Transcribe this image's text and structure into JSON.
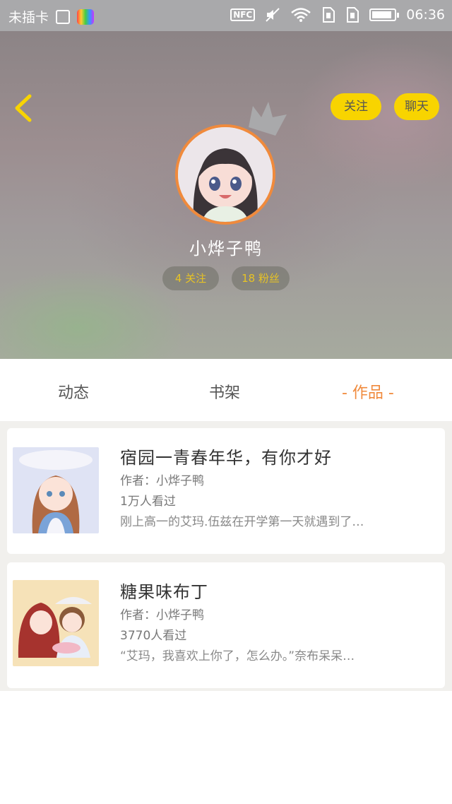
{
  "status_bar": {
    "carrier": "未插卡",
    "nfc": "NFC",
    "time": "06:36",
    "battery_level": 0.8
  },
  "header": {
    "follow_label": "关注",
    "chat_label": "聊天",
    "username": "小烨子鸭",
    "following": "4 关注",
    "fans": "18 粉丝",
    "accent_color": "#f8d400",
    "avatar_border_color": "#f08a3c"
  },
  "tabs": [
    {
      "label": "动态",
      "selected": false
    },
    {
      "label": "书架",
      "selected": false
    },
    {
      "label": "- 作品 -",
      "selected": true
    }
  ],
  "works": [
    {
      "title": "宿园一青春年华，有你才好",
      "author": "作者：小烨子鸭",
      "views": "1万人看过",
      "summary": "刚上高一的艾玛.伍兹在开学第一天就遇到了…"
    },
    {
      "title": "糖果味布丁",
      "author": "作者：小烨子鸭",
      "views": "3770人看过",
      "summary": "“艾玛，我喜欢上你了，怎么办。”奈布呆呆…"
    }
  ]
}
